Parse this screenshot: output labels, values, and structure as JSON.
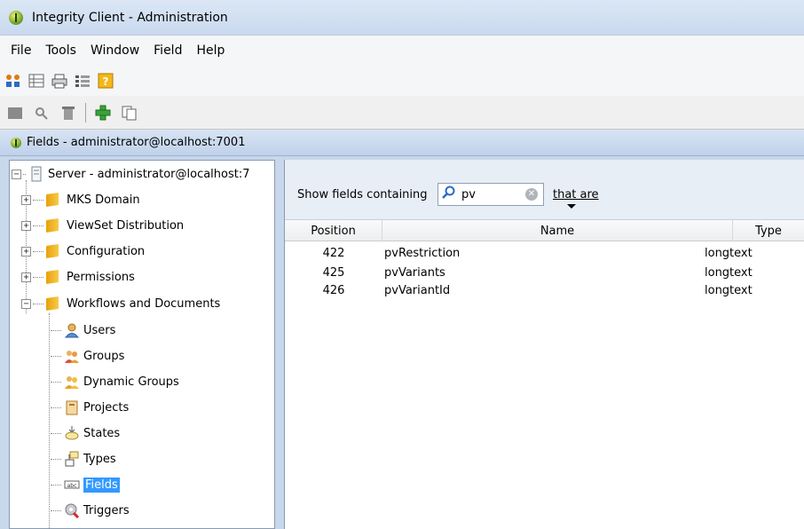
{
  "window": {
    "title": "Integrity Client - Administration"
  },
  "menu": [
    "File",
    "Tools",
    "Window",
    "Field",
    "Help"
  ],
  "subwindow": {
    "title": "Fields - administrator@localhost:7001"
  },
  "tree": {
    "root": "Server - administrator@localhost:7",
    "folders": [
      {
        "label": "MKS Domain",
        "expander": "+"
      },
      {
        "label": "ViewSet Distribution",
        "expander": "+"
      },
      {
        "label": "Configuration",
        "expander": "+"
      },
      {
        "label": "Permissions",
        "expander": "+"
      },
      {
        "label": "Workflows and Documents",
        "expander": "−"
      }
    ],
    "children": [
      {
        "label": "Users",
        "icon": "user-icon"
      },
      {
        "label": "Groups",
        "icon": "group-icon"
      },
      {
        "label": "Dynamic Groups",
        "icon": "dynamic-group-icon"
      },
      {
        "label": "Projects",
        "icon": "project-icon"
      },
      {
        "label": "States",
        "icon": "state-icon"
      },
      {
        "label": "Types",
        "icon": "type-icon"
      },
      {
        "label": "Fields",
        "icon": "field-icon",
        "selected": true
      },
      {
        "label": "Triggers",
        "icon": "trigger-icon"
      }
    ]
  },
  "filter": {
    "label": "Show fields containing",
    "search_value": "pv",
    "that_are": "that are"
  },
  "grid": {
    "columns": [
      "Position",
      "Name",
      "Type"
    ],
    "rows": [
      {
        "position": "422",
        "name": "pvRestriction",
        "type": "longtext"
      },
      {
        "position": "425",
        "name": "pvVariants",
        "type": "longtext"
      },
      {
        "position": "426",
        "name": "pvVariantId",
        "type": "longtext"
      }
    ]
  },
  "colors": {
    "selection": "#3399ff",
    "titlebar": "#c9d9ee",
    "folder": "#e8a10a"
  }
}
